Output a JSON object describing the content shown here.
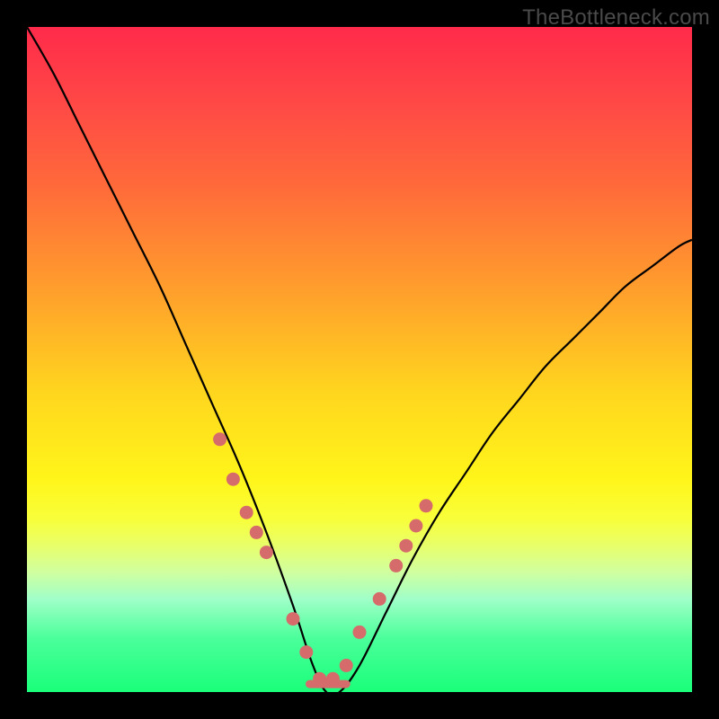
{
  "watermark": "TheBottleneck.com",
  "chart_data": {
    "type": "line",
    "title": "",
    "xlabel": "",
    "ylabel": "",
    "xlim": [
      0,
      100
    ],
    "ylim": [
      0,
      100
    ],
    "optimum_x": 45,
    "series": [
      {
        "name": "bottleneck-curve",
        "x": [
          0,
          4,
          8,
          12,
          16,
          20,
          24,
          28,
          32,
          36,
          40,
          43,
          45,
          47,
          50,
          54,
          58,
          62,
          66,
          70,
          74,
          78,
          82,
          86,
          90,
          94,
          98,
          100
        ],
        "values": [
          100,
          93,
          85,
          77,
          69,
          61,
          52,
          43,
          34,
          24,
          13,
          4,
          0,
          0,
          4,
          12,
          20,
          27,
          33,
          39,
          44,
          49,
          53,
          57,
          61,
          64,
          67,
          68
        ]
      }
    ],
    "dot_markers": {
      "name": "sample-points",
      "color": "#d66b6b",
      "x": [
        29,
        31,
        33,
        34.5,
        36,
        40,
        42,
        44,
        46,
        48,
        50,
        53,
        55.5,
        57,
        58.5,
        60
      ],
      "values": [
        38,
        32,
        27,
        24,
        21,
        11,
        6,
        2,
        2,
        4,
        9,
        14,
        19,
        22,
        25,
        28
      ]
    },
    "flat_segment": {
      "x_start": 42.5,
      "x_end": 48,
      "y": 1.2,
      "stroke_width": 9,
      "color": "#d66b6b"
    }
  }
}
